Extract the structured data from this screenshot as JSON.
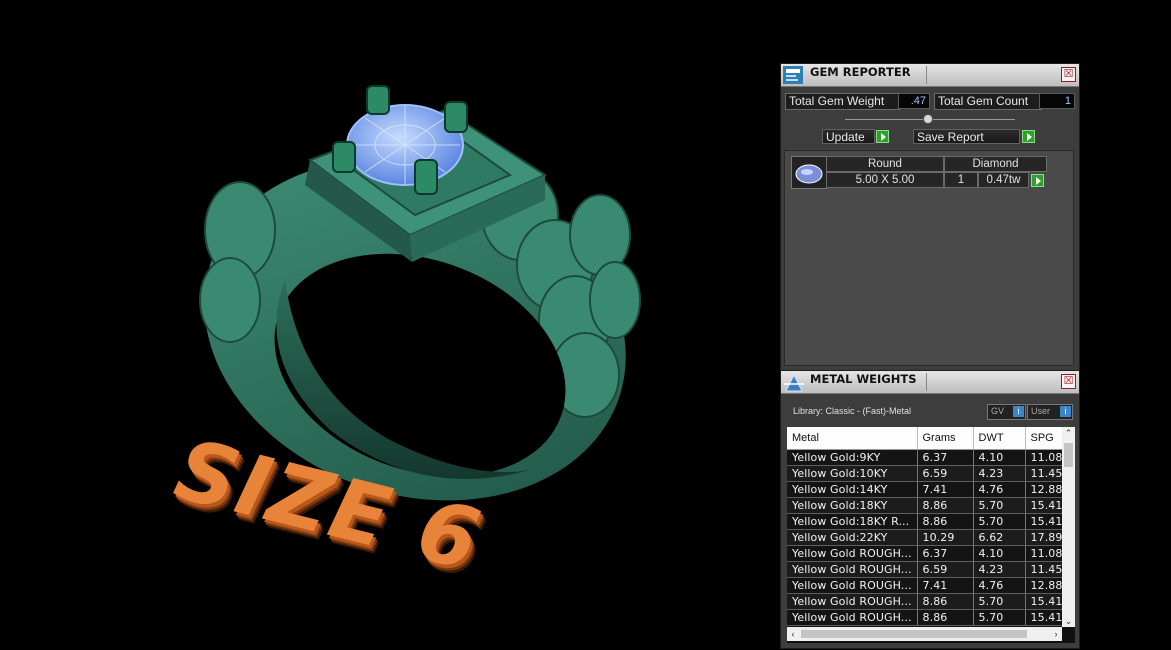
{
  "viewport": {
    "size_label": "SIZE 6"
  },
  "gem_reporter": {
    "title": "GEM REPORTER",
    "close_label": "☒",
    "total_gem_weight_label": "Total Gem Weight",
    "total_gem_weight_value": ".47",
    "total_gem_count_label": "Total Gem Count",
    "total_gem_count_value": "1",
    "update_label": "Update",
    "save_report_label": "Save Report",
    "gem": {
      "shape": "Round",
      "type": "Diamond",
      "size": "5.00 X 5.00",
      "count": "1",
      "weight": "0.47tw"
    }
  },
  "metal_weights": {
    "title": "METAL WEIGHTS",
    "library": "Library: Classic - (Fast)-Metal",
    "gv_label": "GV",
    "user_label": "User",
    "columns": [
      "Metal",
      "Grams",
      "DWT",
      "SPG"
    ],
    "rows": [
      [
        "Yellow Gold:9KY",
        "6.37",
        "4.10",
        "11.08"
      ],
      [
        "Yellow Gold:10KY",
        "6.59",
        "4.23",
        "11.45"
      ],
      [
        "Yellow Gold:14KY",
        "7.41",
        "4.76",
        "12.88"
      ],
      [
        "Yellow Gold:18KY",
        "8.86",
        "5.70",
        "15.41"
      ],
      [
        "Yellow Gold:18KY R...",
        "8.86",
        "5.70",
        "15.41"
      ],
      [
        "Yellow Gold:22KY",
        "10.29",
        "6.62",
        "17.89"
      ],
      [
        "Yellow Gold ROUGH...",
        "6.37",
        "4.10",
        "11.08"
      ],
      [
        "Yellow Gold ROUGH...",
        "6.59",
        "4.23",
        "11.45"
      ],
      [
        "Yellow Gold ROUGH...",
        "7.41",
        "4.76",
        "12.88"
      ],
      [
        "Yellow Gold ROUGH...",
        "8.86",
        "5.70",
        "15.41"
      ],
      [
        "Yellow Gold ROUGH...",
        "8.86",
        "5.70",
        "15.41"
      ]
    ]
  },
  "colors": {
    "ring": "#2f7a62",
    "gem": "#7aa6f0",
    "size_text": "#e8843a",
    "play_green": "#2fa02f"
  }
}
